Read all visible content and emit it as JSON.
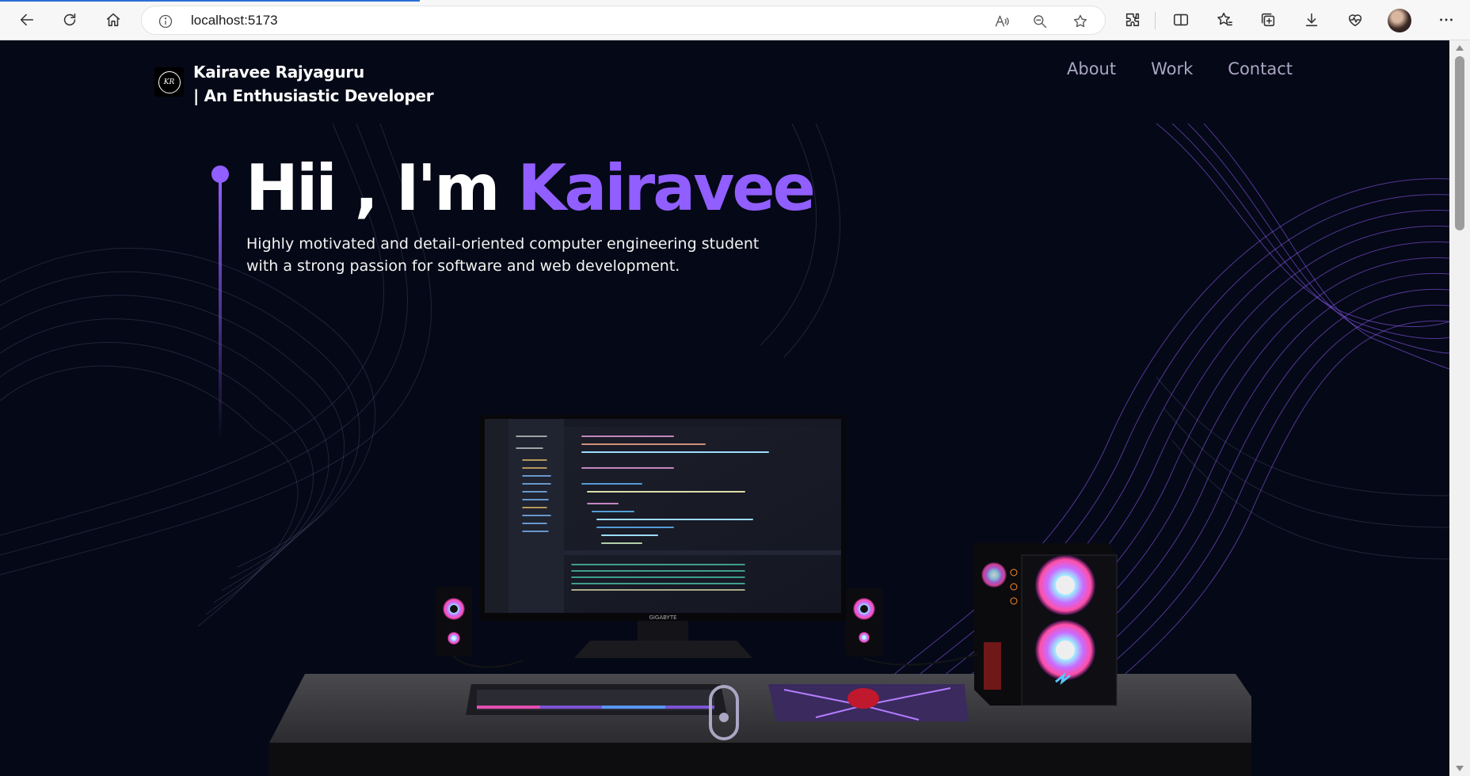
{
  "browser": {
    "url": "localhost:5173",
    "icons": {
      "back": "back-arrow-icon",
      "refresh": "refresh-icon",
      "home": "home-icon",
      "info": "info-icon",
      "read_aloud": "read-aloud-icon",
      "zoom": "zoom-out-icon",
      "favorite": "star-icon",
      "extensions": "extensions-icon",
      "split": "split-screen-icon",
      "favorites": "favorites-icon",
      "collections": "collections-icon",
      "downloads": "download-icon",
      "health": "browser-essentials-icon",
      "profile": "avatar",
      "menu": "more-menu-icon"
    }
  },
  "nav": {
    "brand_line1": "Kairavee Rajyaguru",
    "brand_line2": "| An Enthusiastic Developer",
    "links": [
      "About",
      "Work",
      "Contact"
    ]
  },
  "hero": {
    "greeting": "Hii , I'm ",
    "name": "Kairavee",
    "description_line1": "Highly motivated and detail-oriented computer engineering student",
    "description_line2": "with a strong passion for software and web development."
  },
  "scene": {
    "monitor_brand": "GIGABYTE"
  },
  "colors": {
    "background": "#050816",
    "accent": "#915eff",
    "nav_link": "#aaa6c3",
    "text": "#ffffff"
  }
}
